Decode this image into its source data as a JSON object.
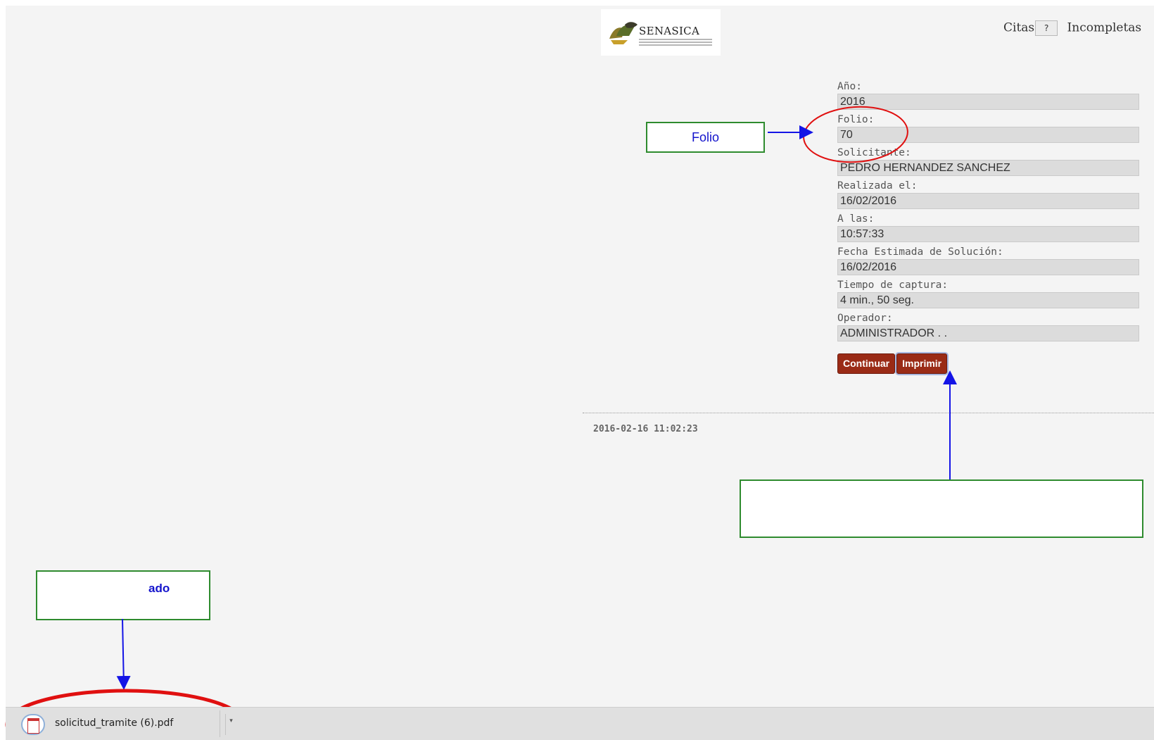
{
  "header": {
    "logo_text": "SENASICA",
    "nav": [
      {
        "label": "Citas",
        "badge": "?"
      },
      {
        "label": "Incompletas"
      }
    ]
  },
  "form": {
    "fields": [
      {
        "label": "Año:",
        "value": "2016"
      },
      {
        "label": "Folio:",
        "value": "70"
      },
      {
        "label": "Solicitante:",
        "value": "PEDRO HERNANDEZ SANCHEZ"
      },
      {
        "label": "Realizada el:",
        "value": "16/02/2016"
      },
      {
        "label": "A las:",
        "value": "10:57:33"
      },
      {
        "label": "Fecha Estimada de Solución:",
        "value": "16/02/2016"
      },
      {
        "label": "Tiempo de captura:",
        "value": "4 min., 50 seg."
      },
      {
        "label": "Operador:",
        "value": "ADMINISTRADOR . ."
      }
    ],
    "buttons": {
      "continuar": "Continuar",
      "imprimir": "Imprimir"
    }
  },
  "timestamp": "2016-02-16 11:02:23",
  "callouts": {
    "folio": "Folio",
    "print": "",
    "download": "ado"
  },
  "download_bar": {
    "file_name": "solicitud_tramite (6).pdf",
    "icon": "pdf-file-icon",
    "menu_icon": "chevron-down-icon"
  },
  "colors": {
    "button_bg": "#9a2b16",
    "callout_border": "#2e8b2e",
    "arrow": "#1414e6",
    "highlight_ellipse": "#e01010"
  }
}
